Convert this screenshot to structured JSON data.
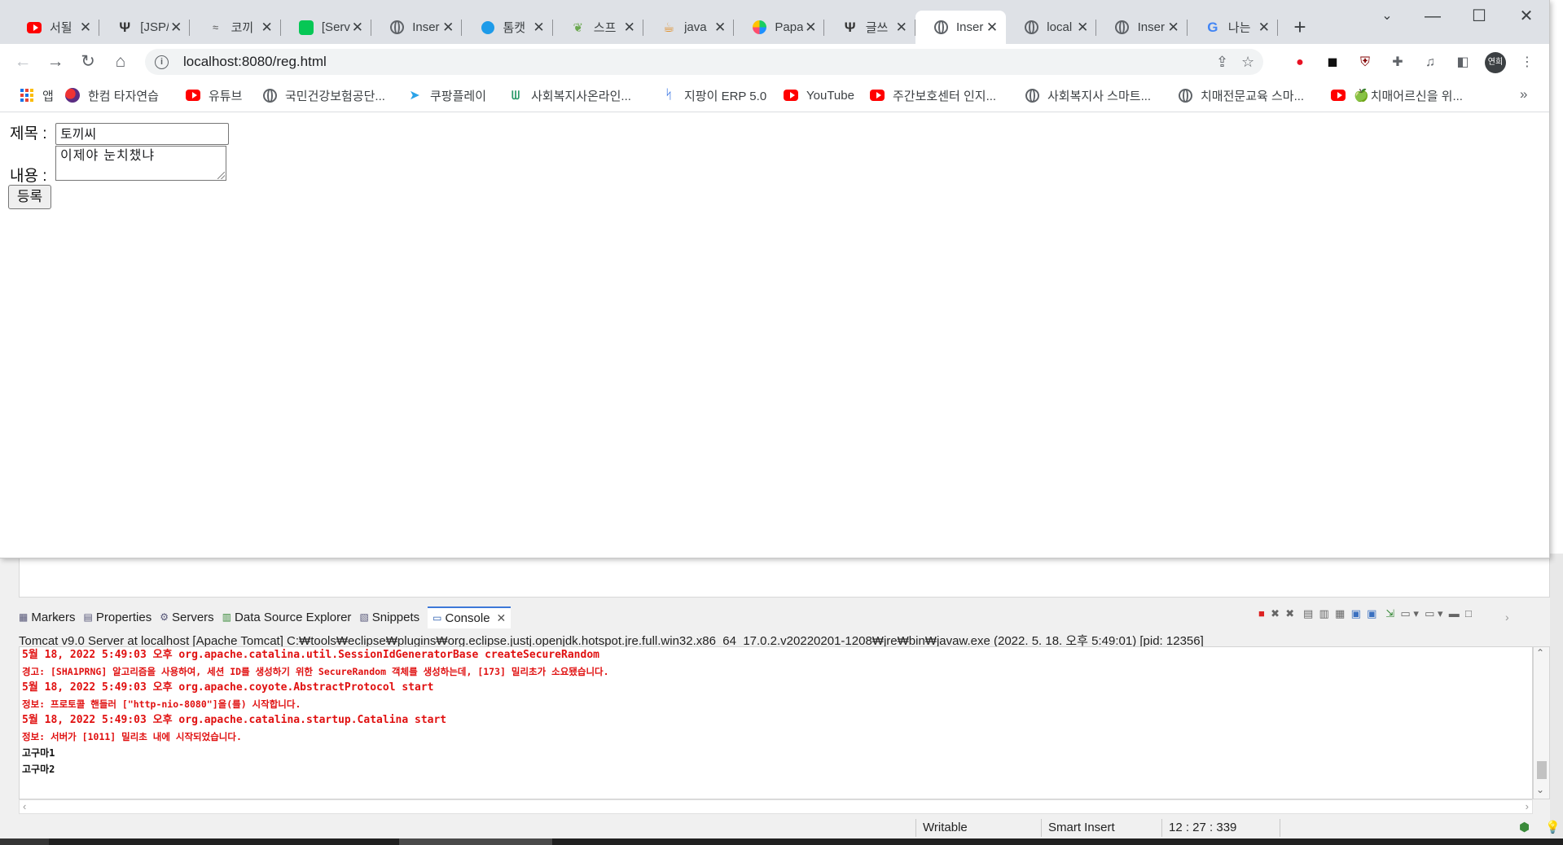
{
  "browser": {
    "tabs": [
      {
        "favicon": "youtube-icon",
        "title": "서될"
      },
      {
        "favicon": "dark-logo-icon",
        "title": "[JSP/"
      },
      {
        "favicon": "cat-icon",
        "title": "코끼"
      },
      {
        "favicon": "line-icon",
        "title": "[Serv"
      },
      {
        "favicon": "globe-icon",
        "title": "Inser"
      },
      {
        "favicon": "blue-circle-icon",
        "title": "톰캣"
      },
      {
        "favicon": "bug-icon",
        "title": "스프"
      },
      {
        "favicon": "cup-icon",
        "title": "java"
      },
      {
        "favicon": "papago-icon",
        "title": "Papa"
      },
      {
        "favicon": "dark-logo-icon",
        "title": "글쓰"
      },
      {
        "favicon": "globe-icon",
        "title": "Inser",
        "active": true
      },
      {
        "favicon": "globe-icon",
        "title": "local"
      },
      {
        "favicon": "globe-icon",
        "title": "Inser"
      },
      {
        "favicon": "google-icon",
        "title": "나는"
      }
    ],
    "new_tab_label": "+",
    "address": "localhost:8080/reg.html",
    "profile_label": "연희",
    "bookmarks": [
      {
        "icon": "apps-icon",
        "label": "앱"
      },
      {
        "icon": "hancom-icon",
        "label": "한컴 타자연습"
      },
      {
        "icon": "youtube-icon",
        "label": "유튜브"
      },
      {
        "icon": "globe-icon",
        "label": "국민건강보험공단..."
      },
      {
        "icon": "coupang-icon",
        "label": "쿠팡플레이"
      },
      {
        "icon": "welfare-icon",
        "label": "사회복지사온라인..."
      },
      {
        "icon": "erp-icon",
        "label": "지팡이 ERP 5.0"
      },
      {
        "icon": "youtube-icon",
        "label": "YouTube"
      },
      {
        "icon": "youtube-icon",
        "label": "주간보호센터 인지..."
      },
      {
        "icon": "globe-icon",
        "label": "사회복지사 스마트..."
      },
      {
        "icon": "globe-icon",
        "label": "치매전문교육 스마..."
      },
      {
        "icon": "youtube-icon",
        "label": "치매어르신을 위..."
      }
    ],
    "bookmarks_more": "»"
  },
  "form": {
    "title_label": "제목 :",
    "title_value": "토끼씨",
    "content_label": "내용 :",
    "content_value": "이제야 눈치챘냐",
    "submit_label": "등록"
  },
  "eclipse": {
    "view_tabs": [
      "Markers",
      "Properties",
      "Servers",
      "Data Source Explorer",
      "Snippets",
      "Console"
    ],
    "server_info": "Tomcat v9.0 Server at localhost [Apache Tomcat] C:₩tools₩eclipse₩plugins₩org.eclipse.justj.openjdk.hotspot.jre.full.win32.x86_64_17.0.2.v20220201-1208₩jre₩bin₩javaw.exe  (2022. 5. 18. 오후 5:49:01) [pid: 12356]",
    "console_lines": [
      {
        "style": "red",
        "text": "5월 18, 2022 5:49:03 오후 org.apache.catalina.util.SessionIdGeneratorBase createSecureRandom"
      },
      {
        "style": "red small",
        "text": "경고: [SHA1PRNG] 알고리즘을 사용하여, 세션 ID를 생성하기 위한 SecureRandom 객체를 생성하는데, [173] 밀리초가 소요됐습니다."
      },
      {
        "style": "red",
        "text": "5월 18, 2022 5:49:03 오후 org.apache.coyote.AbstractProtocol start"
      },
      {
        "style": "red small",
        "text": "정보: 프로토콜 핸들러 [\"http-nio-8080\"]을(를) 시작합니다."
      },
      {
        "style": "red",
        "text": "5월 18, 2022 5:49:03 오후 org.apache.catalina.startup.Catalina start"
      },
      {
        "style": "red small",
        "text": "정보: 서버가 [1011] 밀리초 내에 시작되었습니다."
      },
      {
        "style": "black",
        "text": "고구마1"
      },
      {
        "style": "black",
        "text": "고구마2"
      }
    ],
    "status": {
      "writable": "Writable",
      "insert_mode": "Smart Insert",
      "position": "12 : 27 : 339"
    }
  }
}
